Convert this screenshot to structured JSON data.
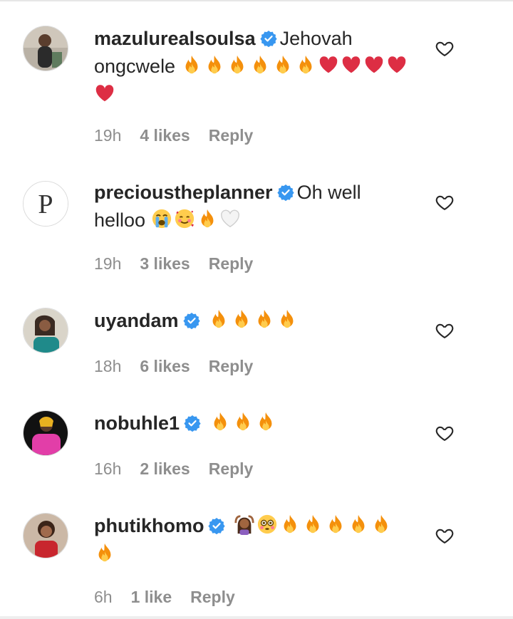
{
  "comments": [
    {
      "username": "mazulurealsoulsa",
      "text": "Jehovah ongcwele",
      "emojis": [
        "fire",
        "fire",
        "fire",
        "fire",
        "fire",
        "fire",
        "red-heart",
        "red-heart",
        "red-heart",
        "red-heart",
        "red-heart"
      ],
      "time": "19h",
      "likes": "4 likes",
      "reply": "Reply"
    },
    {
      "username": "precioustheplanner",
      "text": "Oh well helloo",
      "emojis": [
        "loudly-crying-face",
        "smiling-face-with-hearts",
        "fire",
        "white-heart"
      ],
      "time": "19h",
      "likes": "3 likes",
      "reply": "Reply"
    },
    {
      "username": "uyandam",
      "text": "",
      "emojis": [
        "fire",
        "fire",
        "fire",
        "fire"
      ],
      "time": "18h",
      "likes": "6 likes",
      "reply": "Reply"
    },
    {
      "username": "nobuhle1",
      "text": "",
      "emojis": [
        "fire",
        "fire",
        "fire"
      ],
      "time": "16h",
      "likes": "2 likes",
      "reply": "Reply"
    },
    {
      "username": "phutikhomo",
      "text": "",
      "emojis": [
        "woman-gesturing-ok",
        "flushed-face",
        "fire",
        "fire",
        "fire",
        "fire",
        "fire",
        "fire"
      ],
      "time": "6h",
      "likes": "1 like",
      "reply": "Reply"
    }
  ],
  "colors": {
    "verified": "#3897f0",
    "meta": "#8e8e8e",
    "text": "#262626"
  }
}
